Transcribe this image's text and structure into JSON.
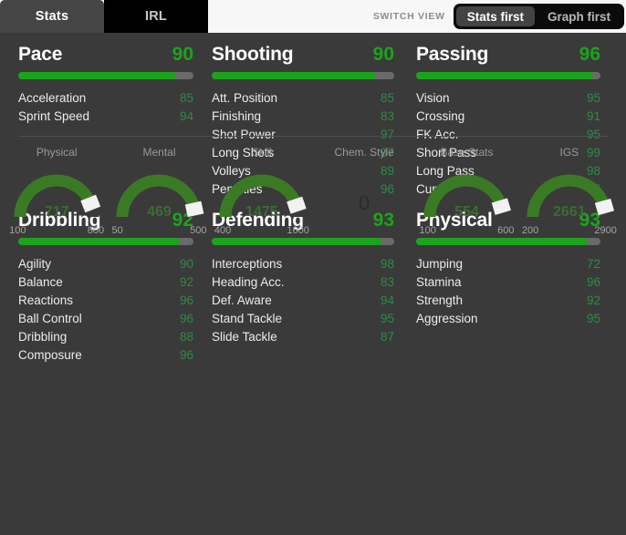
{
  "header": {
    "tabs": [
      {
        "label": "Stats",
        "active": true
      },
      {
        "label": "IRL",
        "active": false
      }
    ],
    "switch_view_label": "SWITCH VIEW",
    "view_options": [
      {
        "label": "Stats first",
        "active": true
      },
      {
        "label": "Graph first",
        "active": false
      }
    ]
  },
  "accent_green": "#1ba41b",
  "substat_green": "#2e8b44",
  "categories": [
    {
      "name": "Pace",
      "rating": 90,
      "bar_pct": 90,
      "stats": [
        {
          "name": "Acceleration",
          "value": 85
        },
        {
          "name": "Sprint Speed",
          "value": 94
        }
      ]
    },
    {
      "name": "Shooting",
      "rating": 90,
      "bar_pct": 90,
      "stats": [
        {
          "name": "Att. Position",
          "value": 85
        },
        {
          "name": "Finishing",
          "value": 83
        },
        {
          "name": "Shot Power",
          "value": 97
        },
        {
          "name": "Long Shots",
          "value": 97
        },
        {
          "name": "Volleys",
          "value": 89
        },
        {
          "name": "Penalties",
          "value": 96
        }
      ]
    },
    {
      "name": "Passing",
      "rating": 96,
      "bar_pct": 96,
      "stats": [
        {
          "name": "Vision",
          "value": 95
        },
        {
          "name": "Crossing",
          "value": 91
        },
        {
          "name": "FK Acc.",
          "value": 95
        },
        {
          "name": "Short Pass",
          "value": 99
        },
        {
          "name": "Long Pass",
          "value": 98
        },
        {
          "name": "Curve",
          "value": 87
        }
      ]
    },
    {
      "name": "Dribbling",
      "rating": 92,
      "bar_pct": 92,
      "stats": [
        {
          "name": "Agility",
          "value": 90
        },
        {
          "name": "Balance",
          "value": 92
        },
        {
          "name": "Reactions",
          "value": 96
        },
        {
          "name": "Ball Control",
          "value": 96
        },
        {
          "name": "Dribbling",
          "value": 88
        },
        {
          "name": "Composure",
          "value": 96
        }
      ]
    },
    {
      "name": "Defending",
      "rating": 93,
      "bar_pct": 93,
      "stats": [
        {
          "name": "Interceptions",
          "value": 98
        },
        {
          "name": "Heading Acc.",
          "value": 83
        },
        {
          "name": "Def. Aware",
          "value": 94
        },
        {
          "name": "Stand Tackle",
          "value": 95
        },
        {
          "name": "Slide Tackle",
          "value": 87
        }
      ]
    },
    {
      "name": "Physical",
      "rating": 93,
      "bar_pct": 93,
      "stats": [
        {
          "name": "Jumping",
          "value": 72
        },
        {
          "name": "Stamina",
          "value": 96
        },
        {
          "name": "Strength",
          "value": 92
        },
        {
          "name": "Aggression",
          "value": 95
        }
      ]
    }
  ],
  "gauges": [
    {
      "title": "Physical",
      "value": 717,
      "min": 100,
      "max": 800,
      "type": "gauge"
    },
    {
      "title": "Mental",
      "value": 469,
      "min": 50,
      "max": 500,
      "type": "gauge"
    },
    {
      "title": "Skill",
      "value": 1475,
      "min": 400,
      "max": 1600,
      "type": "gauge"
    },
    {
      "title": "Chem. Style",
      "value": 0,
      "min": null,
      "max": null,
      "type": "number"
    },
    {
      "title": "Base Stats",
      "value": 554,
      "min": 100,
      "max": 600,
      "type": "gauge"
    },
    {
      "title": "IGS",
      "value": 2661,
      "min": 200,
      "max": 2900,
      "type": "gauge"
    }
  ]
}
